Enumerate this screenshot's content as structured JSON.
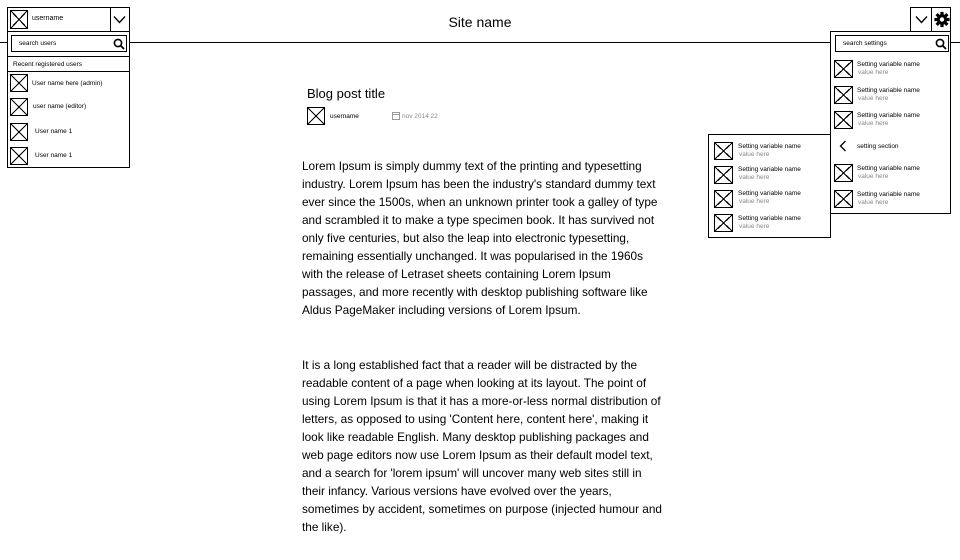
{
  "header": {
    "site_name": "Site name"
  },
  "user_menu": {
    "current_user": "username",
    "avatar_icon": "image-placeholder-icon",
    "dropdown_icon": "chevron-down-icon"
  },
  "user_panel": {
    "search_placeholder": "search users",
    "search_icon": "search-icon",
    "section_label": "Recent registered users",
    "users": [
      {
        "name": "User name here (admin)"
      },
      {
        "name": "user name (editor)"
      },
      {
        "name": "User name 1"
      },
      {
        "name": "User name 1"
      }
    ]
  },
  "post": {
    "title": "Blog post title",
    "author": "username",
    "date": "nov 2014 22",
    "paragraphs": [
      "Lorem Ipsum is simply dummy text of the printing and typesetting industry. Lorem Ipsum has been the industry's standard dummy text ever since the 1500s, when an unknown printer took a galley of type and scrambled it to make a type specimen book. It has survived not only five centuries, but also the leap into electronic typesetting, remaining essentially unchanged. It was popularised in the 1960s with the release of Letraset sheets containing Lorem Ipsum passages, and more recently with desktop publishing software like Aldus PageMaker including versions of Lorem Ipsum.",
      "It is a long established fact that a reader will be distracted by the readable content of a page when looking at its layout. The point of using Lorem Ipsum is that it has a more-or-less normal distribution of letters, as opposed to using 'Content here, content here', making it look like readable English. Many desktop publishing packages and web page editors now use Lorem Ipsum as their default model text, and a search for 'lorem ipsum' will uncover many web sites still in their infancy. Various versions have evolved over the years, sometimes by accident, sometimes on purpose (injected humour and the like)."
    ]
  },
  "settings_menu": {
    "gear_icon": "gear-icon",
    "search_placeholder": "search settings",
    "items": [
      {
        "name": "Setting variable name",
        "value": "value here"
      },
      {
        "name": "Setting variable name",
        "value": "value here"
      },
      {
        "name": "Setting variable name",
        "value": "value here"
      }
    ],
    "section": {
      "label": "setting section",
      "icon": "chevron-left-icon"
    },
    "items_after": [
      {
        "name": "Setting variable name",
        "value": "value here"
      },
      {
        "name": "Setting variable name",
        "value": "value here"
      }
    ]
  },
  "settings_section_panel": {
    "items": [
      {
        "name": "Setting variable name",
        "value": "value here"
      },
      {
        "name": "Setting variable name",
        "value": "value here"
      },
      {
        "name": "Setting variable name",
        "value": "value here"
      },
      {
        "name": "Setting variable name",
        "value": "value here"
      }
    ]
  }
}
